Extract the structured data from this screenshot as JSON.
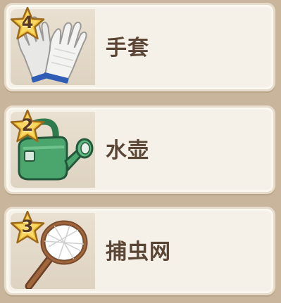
{
  "items": [
    {
      "name": "手套",
      "stars": "4",
      "icon": "gloves-icon"
    },
    {
      "name": "水壶",
      "stars": "2",
      "icon": "watering-can-icon"
    },
    {
      "name": "捕虫网",
      "stars": "3",
      "icon": "bug-net-icon"
    }
  ],
  "colors": {
    "card_bg": "#f5f1e8",
    "icon_panel_bg": "#e4dac9",
    "star_gold": "#f3c33b",
    "text": "#5b4636"
  }
}
